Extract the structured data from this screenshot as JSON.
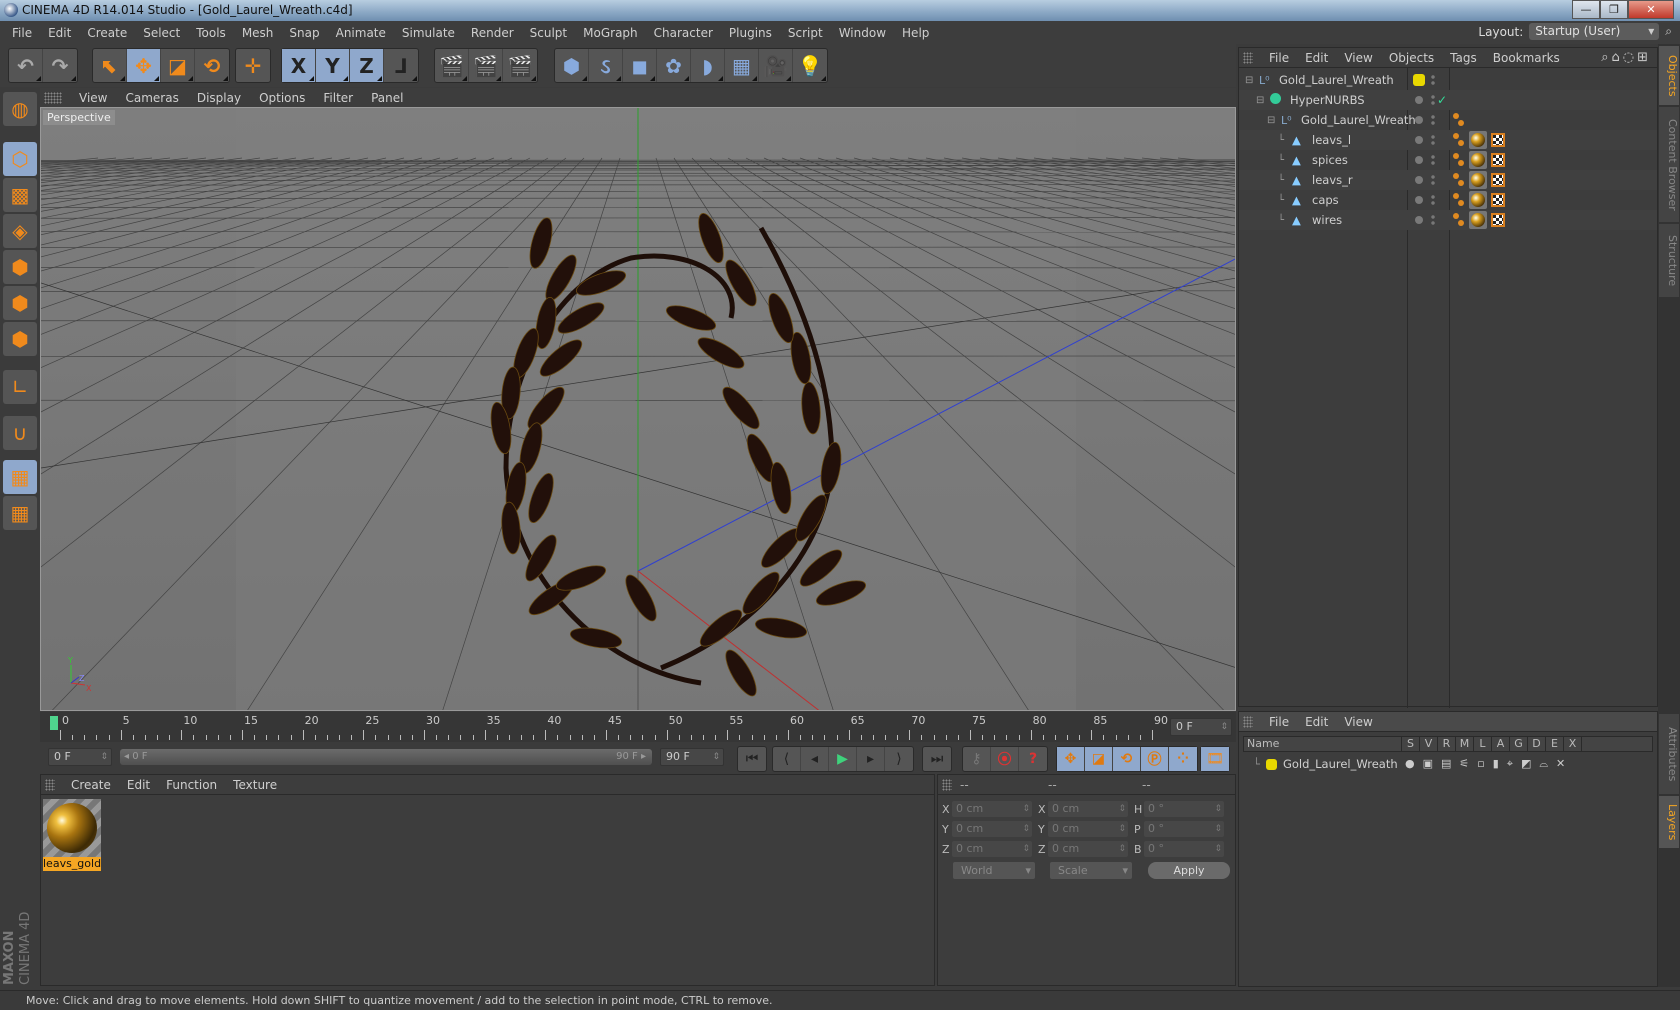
{
  "window": {
    "title": "CINEMA 4D R14.014 Studio - [Gold_Laurel_Wreath.c4d]",
    "controls": {
      "minimize": "—",
      "maximize": "❐",
      "close": "✕"
    }
  },
  "menubar": [
    "File",
    "Edit",
    "Create",
    "Select",
    "Tools",
    "Mesh",
    "Snap",
    "Animate",
    "Simulate",
    "Render",
    "Sculpt",
    "MoGraph",
    "Character",
    "Plugins",
    "Script",
    "Window",
    "Help"
  ],
  "layout": {
    "label": "Layout:",
    "value": "Startup (User)"
  },
  "toolbar": {
    "history": [
      {
        "name": "undo",
        "glyph": "↶"
      },
      {
        "name": "redo",
        "glyph": "↷"
      }
    ],
    "tools": [
      {
        "name": "live-selection",
        "glyph": "⬉"
      },
      {
        "name": "move",
        "glyph": "✥"
      },
      {
        "name": "scale",
        "glyph": "◪"
      },
      {
        "name": "rotate",
        "glyph": "⟲"
      }
    ],
    "last_tool": {
      "name": "recent-tool",
      "glyph": "✛"
    },
    "axes": [
      {
        "name": "x-axis",
        "glyph": "X"
      },
      {
        "name": "y-axis",
        "glyph": "Y"
      },
      {
        "name": "z-axis",
        "glyph": "Z"
      },
      {
        "name": "coordinate-system",
        "glyph": "⅃"
      }
    ],
    "render": [
      {
        "name": "render-view",
        "glyph": "🎬"
      },
      {
        "name": "render-picture-viewer",
        "glyph": "🎬"
      },
      {
        "name": "render-settings",
        "glyph": "🎬"
      }
    ],
    "objects": [
      {
        "name": "cube",
        "glyph": "⬢"
      },
      {
        "name": "spline-pen",
        "glyph": "ઽ"
      },
      {
        "name": "subdivision-surface",
        "glyph": "◼"
      },
      {
        "name": "mograph-cloner",
        "glyph": "✿"
      },
      {
        "name": "deformer-bend",
        "glyph": "◗"
      },
      {
        "name": "floor",
        "glyph": "▦"
      },
      {
        "name": "camera",
        "glyph": "🎥"
      },
      {
        "name": "light",
        "glyph": "💡"
      }
    ]
  },
  "lefttoolbar": [
    {
      "name": "make-editable",
      "glyph": "◍",
      "on": false
    },
    {
      "name": "model-mode",
      "glyph": "⬡",
      "on": true
    },
    {
      "name": "texture-mode",
      "glyph": "▩",
      "on": false
    },
    {
      "name": "workplane-mode",
      "glyph": "◈",
      "on": false
    },
    {
      "name": "points-mode",
      "glyph": "⬢",
      "on": false
    },
    {
      "name": "edges-mode",
      "glyph": "⬢",
      "on": false
    },
    {
      "name": "polygons-mode",
      "glyph": "⬢",
      "on": false
    },
    {
      "name": "axis-mode",
      "glyph": "∟",
      "on": false
    },
    {
      "name": "snapping",
      "glyph": "∪",
      "on": false
    },
    {
      "name": "locked-workplane",
      "glyph": "▦",
      "on": true
    },
    {
      "name": "planar-workplane",
      "glyph": "▦",
      "on": false
    }
  ],
  "viewport": {
    "menu": [
      "View",
      "Cameras",
      "Display",
      "Options",
      "Filter",
      "Panel"
    ],
    "label": "Perspective",
    "nav_icons": "✥ ⬍ ⟳ ◱",
    "axis": {
      "x": "X",
      "y": "Y",
      "z": "Z"
    }
  },
  "timeline": {
    "labels": [
      "0",
      "5",
      "10",
      "15",
      "20",
      "25",
      "30",
      "35",
      "40",
      "45",
      "50",
      "55",
      "60",
      "65",
      "70",
      "75",
      "80",
      "85",
      "90"
    ],
    "current_frame": "0 F",
    "start_field": "0 F",
    "range_start": "◂ 0 F",
    "range_end": "90 F ▸",
    "end_field": "90 F"
  },
  "transport": {
    "playback": [
      {
        "name": "go-to-start",
        "glyph": "⏮"
      },
      {
        "name": "previous-key",
        "glyph": "⟨"
      },
      {
        "name": "previous-frame",
        "glyph": "◂"
      },
      {
        "name": "play-forward",
        "glyph": "▶"
      },
      {
        "name": "next-frame",
        "glyph": "▸"
      },
      {
        "name": "next-key",
        "glyph": "⟩"
      },
      {
        "name": "go-to-end",
        "glyph": "⏭"
      }
    ],
    "keys": [
      {
        "name": "record-keyframe",
        "glyph": "⚷"
      },
      {
        "name": "autokeying",
        "glyph": "⦿"
      },
      {
        "name": "keyframe-selection",
        "glyph": "?"
      }
    ],
    "key_channels": [
      {
        "name": "key-position",
        "glyph": "✥"
      },
      {
        "name": "key-scale",
        "glyph": "◪"
      },
      {
        "name": "key-rotation",
        "glyph": "⟲"
      },
      {
        "name": "key-parameter",
        "glyph": "Ⓟ"
      },
      {
        "name": "key-point-level",
        "glyph": "⁘"
      }
    ],
    "timeline_button": {
      "name": "timeline",
      "glyph": "🎞"
    }
  },
  "material_manager": {
    "menu": [
      "Create",
      "Edit",
      "Function",
      "Texture"
    ],
    "materials": [
      {
        "name": "leavs_gold"
      }
    ]
  },
  "coordinates": {
    "headers": [
      "--",
      "--",
      "--"
    ],
    "rows": [
      {
        "l1": "X",
        "v1": "0 cm",
        "l2": "X",
        "v2": "0 cm",
        "l3": "H",
        "v3": "0 °"
      },
      {
        "l1": "Y",
        "v1": "0 cm",
        "l2": "Y",
        "v2": "0 cm",
        "l3": "P",
        "v3": "0 °"
      },
      {
        "l1": "Z",
        "v1": "0 cm",
        "l2": "Z",
        "v2": "0 cm",
        "l3": "B",
        "v3": "0 °"
      }
    ],
    "space": "World",
    "mode": "Scale",
    "apply": "Apply"
  },
  "object_manager": {
    "menu": [
      "File",
      "Edit",
      "View",
      "Objects",
      "Tags",
      "Bookmarks"
    ],
    "objects": [
      {
        "name": "Gold_Laurel_Wreath",
        "type": "null",
        "depth": 0,
        "layer": "#e8d800",
        "tags": false,
        "phong": false
      },
      {
        "name": "HyperNURBS",
        "type": "hypernurbs",
        "depth": 1,
        "layer": null,
        "check": "✓",
        "tags": false,
        "phong": false
      },
      {
        "name": "Gold_Laurel_Wreath",
        "type": "null",
        "depth": 2,
        "layer": null,
        "tags": false,
        "phong": true
      },
      {
        "name": "leavs_l",
        "type": "polygon",
        "depth": 3,
        "layer": null,
        "tags": true,
        "phong": true
      },
      {
        "name": "spices",
        "type": "polygon",
        "depth": 3,
        "layer": null,
        "tags": true,
        "phong": true
      },
      {
        "name": "leavs_r",
        "type": "polygon",
        "depth": 3,
        "layer": null,
        "tags": true,
        "phong": true
      },
      {
        "name": "caps",
        "type": "polygon",
        "depth": 3,
        "layer": null,
        "tags": true,
        "phong": true
      },
      {
        "name": "wires",
        "type": "polygon",
        "depth": 3,
        "layer": null,
        "tags": true,
        "phong": true
      }
    ]
  },
  "side_tabs_top": [
    {
      "label": "Objects",
      "active": true
    },
    {
      "label": "Content Browser",
      "active": false
    },
    {
      "label": "Structure",
      "active": false
    }
  ],
  "side_tabs_bottom": [
    {
      "label": "Attributes",
      "active": false
    },
    {
      "label": "Layers",
      "active": true
    }
  ],
  "layer_manager": {
    "menu": [
      "File",
      "Edit",
      "View"
    ],
    "columns": [
      "Name",
      "S",
      "V",
      "R",
      "M",
      "L",
      "A",
      "G",
      "D",
      "E",
      "X"
    ],
    "layers": [
      {
        "name": "Gold_Laurel_Wreath",
        "color": "#e8d800"
      }
    ]
  },
  "brand": {
    "maxon": "MAXON",
    "product": "CINEMA 4D"
  },
  "status": "Move: Click and drag to move elements. Hold down SHIFT to quantize movement / add to the selection in point mode, CTRL to remove."
}
